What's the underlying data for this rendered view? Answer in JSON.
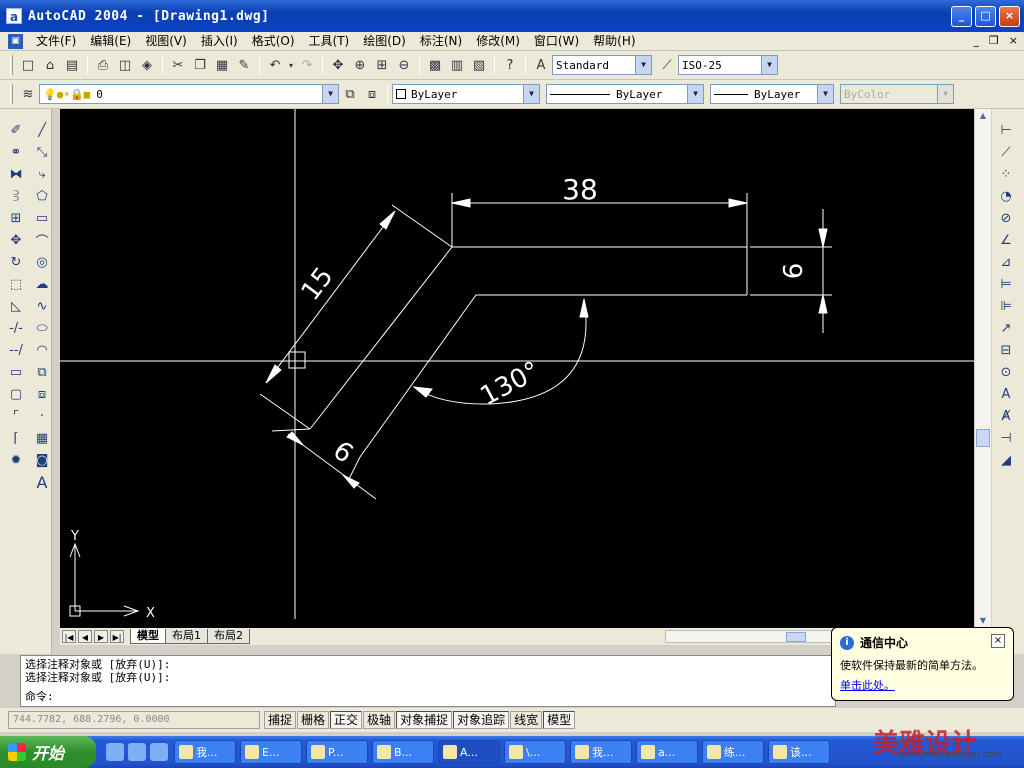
{
  "window": {
    "app_icon": "a",
    "title": "AutoCAD 2004 - [Drawing1.dwg]",
    "minimize": "_",
    "maximize": "□",
    "close": "×",
    "mdi_minimize": "_",
    "mdi_restore": "❐",
    "mdi_close": "×"
  },
  "menu": [
    "文件(F)",
    "编辑(E)",
    "视图(V)",
    "插入(I)",
    "格式(O)",
    "工具(T)",
    "绘图(D)",
    "标注(N)",
    "修改(M)",
    "窗口(W)",
    "帮助(H)"
  ],
  "toolbar1": {
    "text_style": "Standard",
    "dim_style": "ISO-25"
  },
  "toolbar2": {
    "layer_value": "0",
    "color_value": "ByLayer",
    "linetype_value": "ByLayer",
    "lineweight_value": "ByLayer",
    "plotstyle_value": "ByColor"
  },
  "drawing": {
    "dim_top": "38",
    "dim_right": "6",
    "dim_slant": "15",
    "dim_bottom": "6",
    "dim_angle": "130°",
    "axis_x": "X",
    "axis_y": "Y"
  },
  "layout_tabs": [
    "模型",
    "布局1",
    "布局2"
  ],
  "command": {
    "line1": "选择注释对象或 [放弃(U)]:",
    "line2": "选择注释对象或 [放弃(U)]:",
    "prompt": "命令:"
  },
  "status": {
    "coords": "744.7782, 688.2796, 0.0000",
    "buttons": [
      "捕捉",
      "栅格",
      "正交",
      "极轴",
      "对象捕捉",
      "对象追踪",
      "线宽",
      "模型"
    ]
  },
  "balloon": {
    "title": "通信中心",
    "message": "使软件保持最新的简单方法。",
    "link": "单击此处。"
  },
  "taskbar": {
    "start_label": "开始",
    "tasks": [
      "我...",
      "E...",
      "P...",
      "B...",
      "A...",
      "\\...",
      "我...",
      "a...",
      "练...",
      "该..."
    ]
  },
  "watermark": {
    "brand": "美雅设计",
    "url": "www.meiyadesign.com"
  },
  "colors": {
    "canvas_bg": "#000000",
    "drawing_lines": "#ffffff",
    "titlebar": "#0a3fb4",
    "link": "#0000ff"
  }
}
